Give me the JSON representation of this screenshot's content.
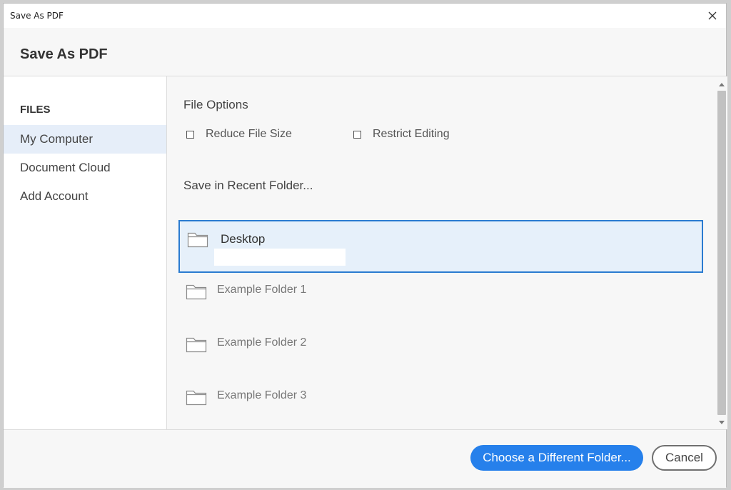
{
  "window": {
    "title": "Save As PDF"
  },
  "header": {
    "heading": "Save As PDF"
  },
  "sidebar": {
    "section_label": "FILES",
    "items": [
      {
        "label": "My Computer",
        "selected": true
      },
      {
        "label": "Document Cloud",
        "selected": false
      },
      {
        "label": "Add Account",
        "selected": false
      }
    ]
  },
  "file_options": {
    "label": "File Options",
    "reduce_file_size": {
      "label": "Reduce File Size",
      "checked": false
    },
    "restrict_editing": {
      "label": "Restrict Editing",
      "checked": false
    }
  },
  "recent": {
    "label": "Save in Recent Folder...",
    "folders": [
      {
        "name": "Desktop",
        "selected": true
      },
      {
        "name": "Example Folder 1",
        "selected": false
      },
      {
        "name": "Example Folder 2",
        "selected": false
      },
      {
        "name": "Example Folder 3",
        "selected": false
      }
    ]
  },
  "footer": {
    "choose_label": "Choose a Different Folder...",
    "cancel_label": "Cancel"
  },
  "colors": {
    "accent": "#2680eb",
    "selected_bg": "#e6f0fa",
    "selected_border": "#2a7bd0"
  },
  "icons": {
    "close": "close-icon",
    "folder": "folder-icon",
    "scroll_up": "scroll-up-arrow-icon",
    "scroll_down": "scroll-down-arrow-icon"
  }
}
